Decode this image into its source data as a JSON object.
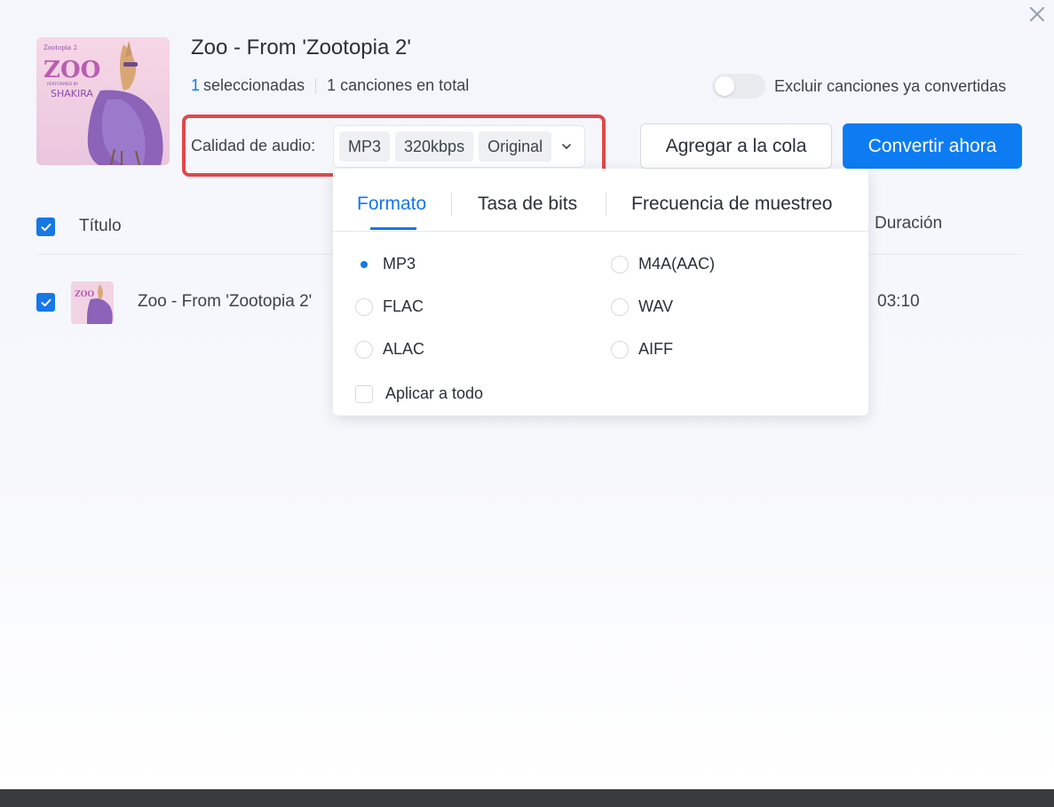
{
  "header": {
    "album_title": "Zoo - From 'Zootopia 2'",
    "selected_count": "1",
    "selected_label": "seleccionadas",
    "total_label": "1 canciones en total",
    "exclude_toggle_label": "Excluir canciones ya convertidas",
    "exclude_toggle_on": false
  },
  "cover": {
    "top_text": "Zootopia 2",
    "main_text": "ZOO",
    "sub_text": "PERFORMED BY",
    "artist_text": "SHAKIRA"
  },
  "quality": {
    "label": "Calidad de audio:",
    "format": "MP3",
    "bitrate": "320kbps",
    "sample_rate": "Original"
  },
  "actions": {
    "queue_label": "Agregar a la cola",
    "convert_label": "Convertir ahora"
  },
  "table": {
    "headers": {
      "title": "Título",
      "duration": "Duración"
    },
    "rows": [
      {
        "title": "Zoo - From 'Zootopia 2'",
        "duration": "03:10",
        "checked": true
      }
    ]
  },
  "popup": {
    "tabs": [
      "Formato",
      "Tasa de bits",
      "Frecuencia de muestreo"
    ],
    "active_tab": "Formato",
    "options": [
      "MP3",
      "M4A(AAC)",
      "FLAC",
      "WAV",
      "ALAC",
      "AIFF"
    ],
    "selected_option": "MP3",
    "apply_all_label": "Aplicar a todo"
  },
  "icons": {
    "close": "close-icon",
    "chevron": "chevron-down-icon",
    "check": "check-icon"
  },
  "colors": {
    "accent": "#1677e6",
    "convert_button": "#0d7cf2",
    "highlight_border": "#e0484b"
  }
}
